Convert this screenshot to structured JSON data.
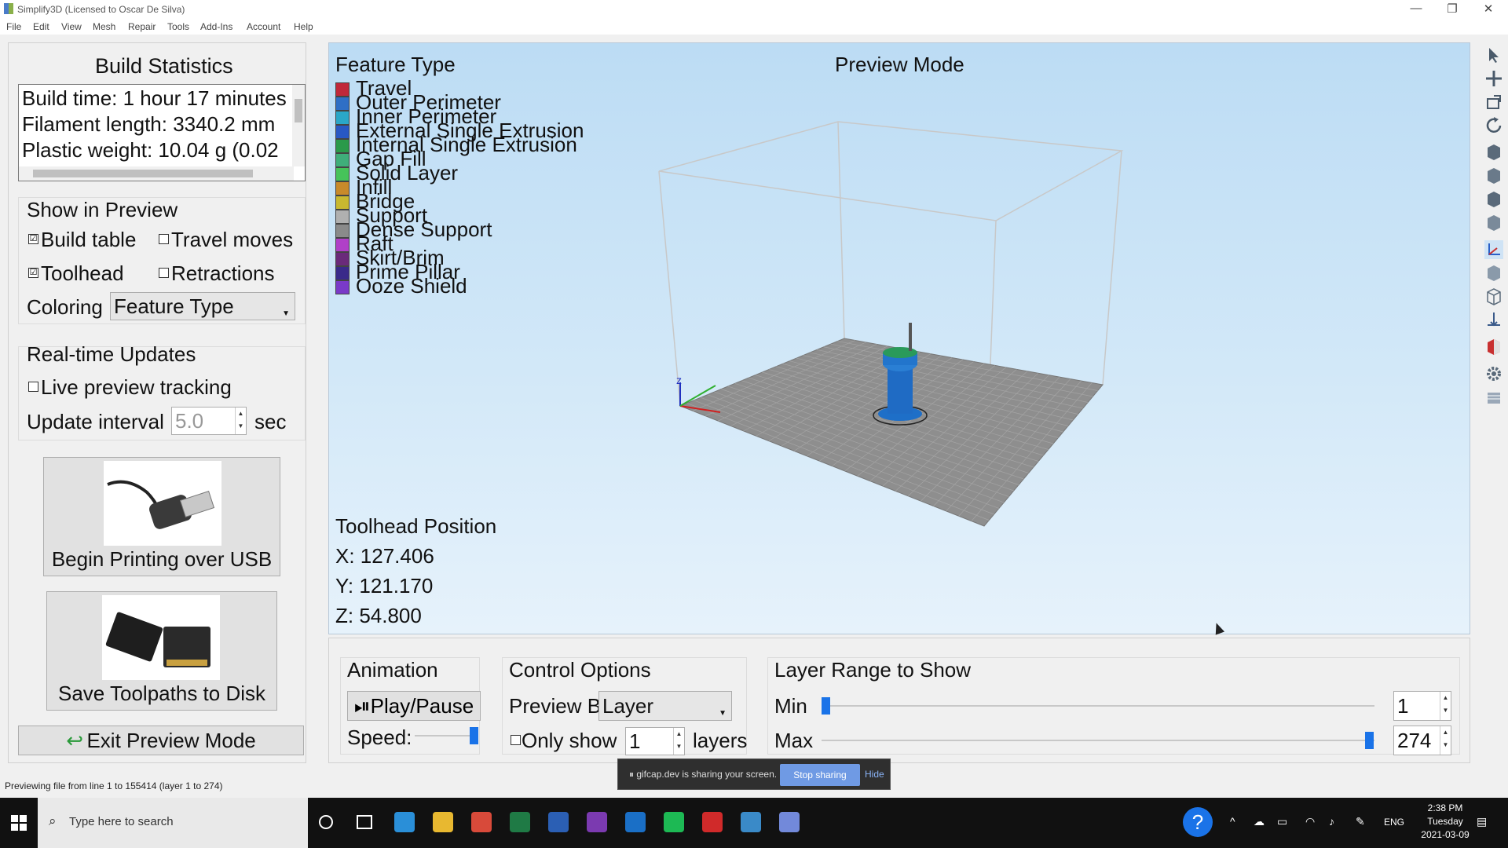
{
  "window": {
    "title": "Simplify3D (Licensed to Oscar De Silva)",
    "minimize_glyph": "—",
    "restore_glyph": "❐",
    "close_glyph": "✕"
  },
  "menu": [
    "File",
    "Edit",
    "View",
    "Mesh",
    "Repair",
    "Tools",
    "Add-Ins",
    "Account",
    "Help"
  ],
  "left": {
    "build_stats_title": "Build Statistics",
    "stats": [
      "Build time: 1 hour 17 minutes",
      "Filament length: 3340.2 mm",
      "Plastic weight: 10.04 g (0.02"
    ],
    "show_in_preview_title": "Show in Preview",
    "build_table_label": "Build table",
    "travel_moves_label": "Travel moves",
    "toolhead_label": "Toolhead",
    "retractions_label": "Retractions",
    "coloring_label": "Coloring",
    "coloring_value": "Feature Type",
    "realtime_title": "Real-time Updates",
    "live_preview_label": "Live preview tracking",
    "update_interval_label": "Update interval",
    "update_interval_value": "5.0",
    "update_interval_unit": "sec",
    "usb_button_label": "Begin Printing over USB",
    "disk_button_label": "Save Toolpaths to Disk",
    "exit_button_label": "Exit Preview Mode",
    "checks": {
      "build_table": "☑",
      "travel_moves": "",
      "toolhead": "☑",
      "retractions": "",
      "live_preview": ""
    }
  },
  "viewport": {
    "legend_title": "Feature Type",
    "mode_title": "Preview Mode",
    "legend": [
      {
        "name": "Travel",
        "color": "#c0283a"
      },
      {
        "name": "Outer Perimeter",
        "color": "#2f6fc6"
      },
      {
        "name": "Inner Perimeter",
        "color": "#2aa7c8"
      },
      {
        "name": "External Single Extrusion",
        "color": "#2858c4"
      },
      {
        "name": "Internal Single Extrusion",
        "color": "#2a9a4a"
      },
      {
        "name": "Gap Fill",
        "color": "#3fae7a"
      },
      {
        "name": "Solid Layer",
        "color": "#46c35a"
      },
      {
        "name": "Infill",
        "color": "#c88a2a"
      },
      {
        "name": "Bridge",
        "color": "#c8b830"
      },
      {
        "name": "Support",
        "color": "#b0b0b0"
      },
      {
        "name": "Dense Support",
        "color": "#8a8a8a"
      },
      {
        "name": "Raft",
        "color": "#b040c8"
      },
      {
        "name": "Skirt/Brim",
        "color": "#6a2a7a"
      },
      {
        "name": "Prime Pillar",
        "color": "#3a2a8a"
      },
      {
        "name": "Ooze Shield",
        "color": "#7a3ac8"
      }
    ],
    "toolhead_title": "Toolhead Position",
    "x": "X: 127.406",
    "y": "Y: 121.170",
    "z": "Z: 54.800",
    "axis_z_label": "z"
  },
  "bottom": {
    "animation_title": "Animation",
    "play_pause_label": "⏯Play/Pause",
    "speed_label": "Speed:",
    "speed_fraction": 1.0,
    "control_title": "Control Options",
    "preview_by_label": "Preview By",
    "preview_by_value": "Layer",
    "only_show_label": "Only show",
    "only_show_value": "1",
    "layers_label": "layers",
    "layer_range_title": "Layer Range to Show",
    "min_label": "Min",
    "max_label": "Max",
    "min_value": "1",
    "max_value": "274"
  },
  "status": {
    "text": "Previewing file from line 1 to 155414 (layer 1 to 274)"
  },
  "sharing": {
    "message": "gifcap.dev is sharing your screen.",
    "stop_label": "Stop sharing",
    "hide_label": "Hide"
  },
  "taskbar": {
    "search_placeholder": "Type here to search",
    "lang": "ENG",
    "time": "2:38 PM",
    "day": "Tuesday",
    "date": "2021-03-09",
    "apps": [
      {
        "name": "edge-icon",
        "color": "#2a8fd8"
      },
      {
        "name": "file-explorer-icon",
        "color": "#e8b830"
      },
      {
        "name": "chrome-icon",
        "color": "#d84a3a"
      },
      {
        "name": "excel-icon",
        "color": "#1f7a45"
      },
      {
        "name": "word-icon",
        "color": "#2b5fb4"
      },
      {
        "name": "onenote-icon",
        "color": "#7b3ab0"
      },
      {
        "name": "outlook-icon",
        "color": "#1a6fc6"
      },
      {
        "name": "spotify-icon",
        "color": "#1db954"
      },
      {
        "name": "solidworks-icon",
        "color": "#d02a2a"
      },
      {
        "name": "simplify3d-icon",
        "color": "#3a8ac8"
      },
      {
        "name": "discord-icon",
        "color": "#7289da"
      }
    ]
  }
}
